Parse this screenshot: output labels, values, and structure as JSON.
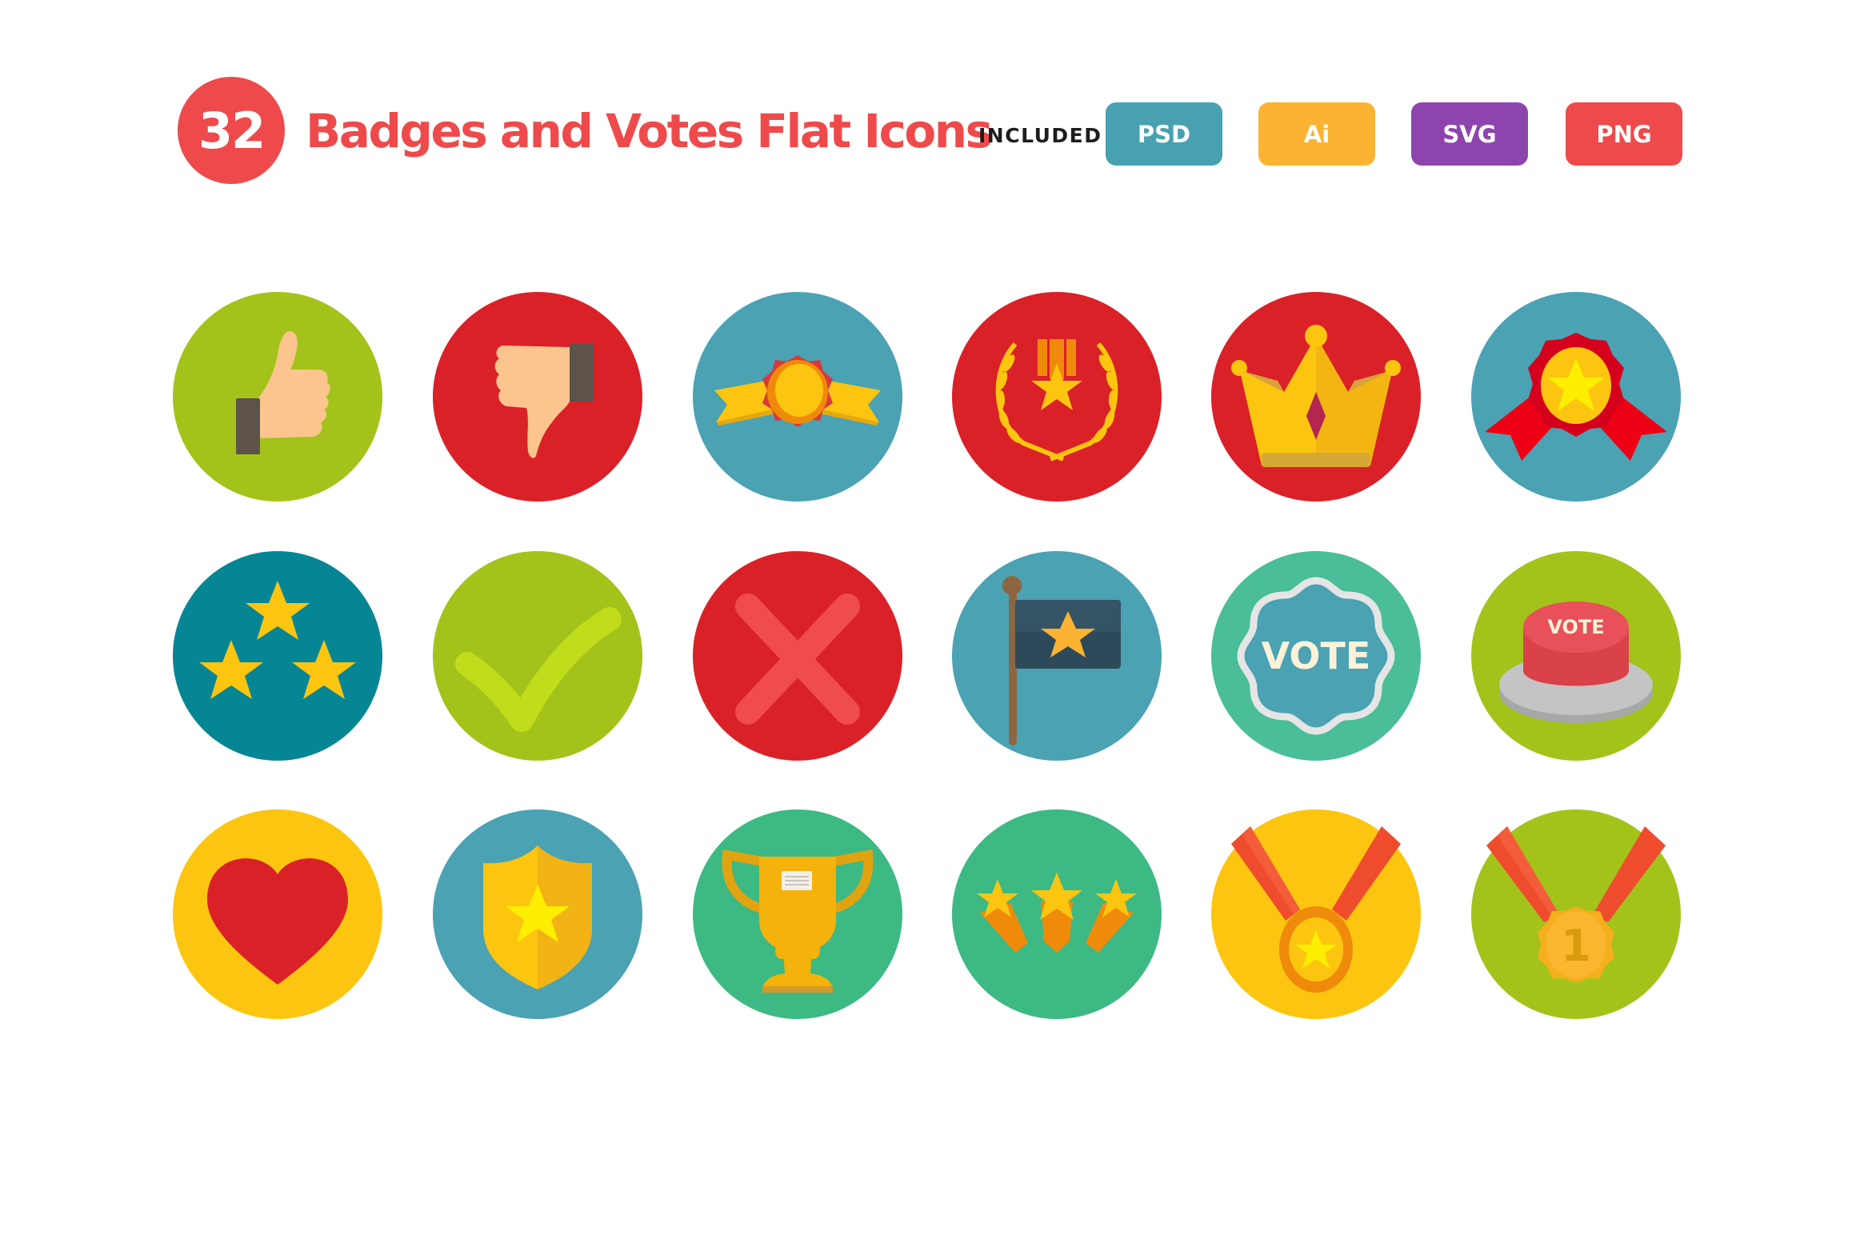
{
  "header": {
    "count": "32",
    "title": "Badges and Votes Flat Icons",
    "included_label": "INCLUDED",
    "brand_color": "#ef4a4b",
    "formats": [
      {
        "label": "PSD",
        "color": "#48a1b0"
      },
      {
        "label": "Ai",
        "color": "#fbb331"
      },
      {
        "label": "SVG",
        "color": "#8e44ad"
      },
      {
        "label": "PNG",
        "color": "#ef4a4b"
      }
    ]
  },
  "icons": [
    {
      "name": "thumbs-up",
      "bg": "#a3c31b"
    },
    {
      "name": "thumbs-down",
      "bg": "#da2128"
    },
    {
      "name": "ribbon-seal",
      "bg": "#4aa2b3"
    },
    {
      "name": "laurel-medal",
      "bg": "#da2128"
    },
    {
      "name": "crown",
      "bg": "#da2128"
    },
    {
      "name": "rosette-star",
      "bg": "#4aa2b3"
    },
    {
      "name": "three-stars",
      "bg": "#068595"
    },
    {
      "name": "checkmark",
      "bg": "#a3c31b"
    },
    {
      "name": "cross",
      "bg": "#da2128"
    },
    {
      "name": "star-flag",
      "bg": "#4aa2b3"
    },
    {
      "name": "vote-badge",
      "bg": "#4abd99",
      "text": "VOTE"
    },
    {
      "name": "vote-button",
      "bg": "#a3c31b",
      "text": "VOTE"
    },
    {
      "name": "heart",
      "bg": "#fcc50f"
    },
    {
      "name": "shield-star",
      "bg": "#4aa2b3"
    },
    {
      "name": "trophy",
      "bg": "#3db984"
    },
    {
      "name": "shooting-stars",
      "bg": "#3db984"
    },
    {
      "name": "star-medal",
      "bg": "#fcc50f"
    },
    {
      "name": "first-place-medal",
      "bg": "#a3c31b",
      "text": "1"
    }
  ]
}
